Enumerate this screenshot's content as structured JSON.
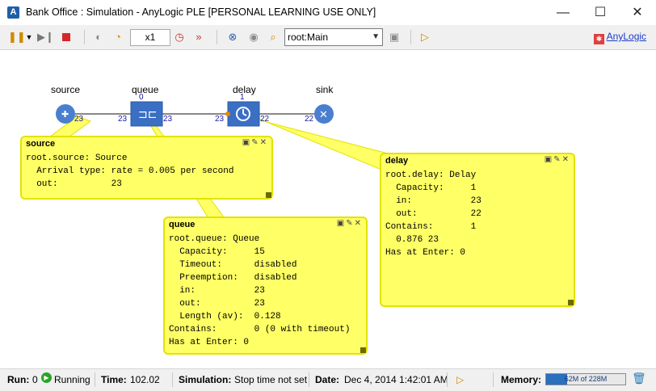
{
  "window": {
    "title": "Bank Office : Simulation - AnyLogic PLE [PERSONAL LEARNING USE ONLY]",
    "minimize": "—",
    "maximize": "☐",
    "close": "✕"
  },
  "toolbar": {
    "speed": "x1",
    "root_selected": "root:Main",
    "brand": "AnyLogic"
  },
  "model": {
    "blocks": [
      {
        "label": "source",
        "out": "23"
      },
      {
        "label": "queue",
        "count": "0",
        "in": "23",
        "out": "23"
      },
      {
        "label": "delay",
        "count": "1",
        "in": "23",
        "out": "22"
      },
      {
        "label": "sink",
        "in": "22"
      }
    ],
    "edge_source_in": "23",
    "edge_delay_out": "22"
  },
  "inspect": {
    "source": {
      "title": "source",
      "lines": [
        "root.source: Source",
        "  Arrival type: rate = 0.005 per second",
        "  out:          23"
      ]
    },
    "queue": {
      "title": "queue",
      "lines": [
        "root.queue: Queue",
        "  Capacity:     15",
        "  Timeout:      disabled",
        "  Preemption:   disabled",
        "  in:           23",
        "  out:          23",
        "  Length (av):  0.128",
        "Contains:       0 (0 with timeout)",
        "Has at Enter: 0"
      ]
    },
    "delay": {
      "title": "delay",
      "lines": [
        "root.delay: Delay",
        "  Capacity:     1",
        "  in:           23",
        "  out:          22",
        "Contains:       1",
        "  0.876 23",
        "Has at Enter: 0"
      ]
    }
  },
  "status": {
    "run_label": "Run:",
    "run_value": "0",
    "run_state": "Running",
    "time_label": "Time:",
    "time_value": "102.02",
    "sim_label": "Simulation:",
    "sim_value": "Stop time not set",
    "date_label": "Date:",
    "date_value": "Dec 4, 2014 1:42:01 AM",
    "memory_label": "Memory:",
    "memory_value": "62M of 228M",
    "memory_fraction": 0.27
  },
  "colors": {
    "block_blue": "#3a6fc4",
    "inspect_yellow": "#ffff66",
    "inspect_border": "#e3e300",
    "link_blue": "#1a3cc9"
  }
}
